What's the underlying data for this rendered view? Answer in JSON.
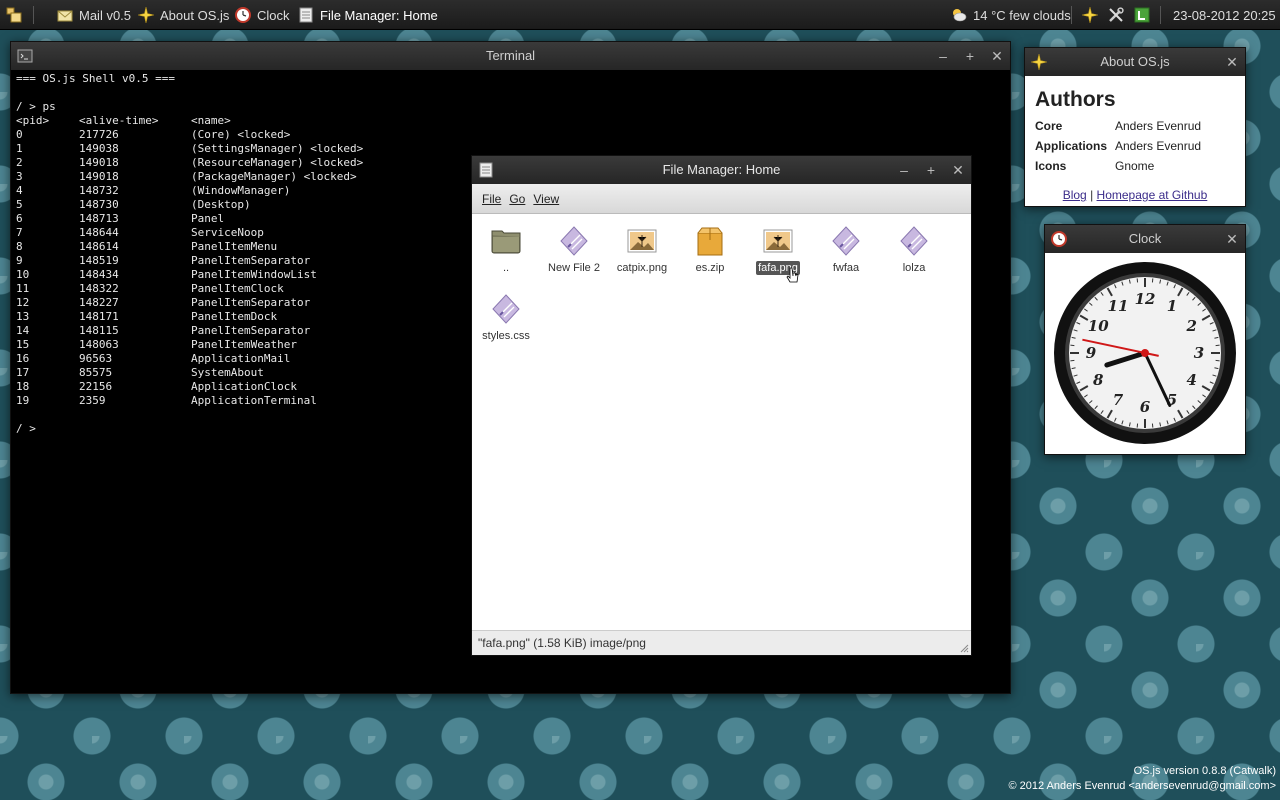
{
  "panel": {
    "items": [
      {
        "label": "Mail v0.5",
        "icon": "mail-icon"
      },
      {
        "label": "About OS.js",
        "icon": "star-icon"
      },
      {
        "label": "Clock",
        "icon": "clock-icon"
      },
      {
        "label": "File Manager: Home",
        "icon": "file-manager-icon"
      }
    ],
    "weather": "14 °C few clouds",
    "datetime": "23-08-2012 20:25"
  },
  "terminal": {
    "title": "Terminal",
    "banner": "=== OS.js Shell v0.5 ===",
    "command": "/ > ps",
    "headers": [
      "<pid>",
      "<alive-time>",
      "<name>"
    ],
    "rows": [
      [
        "0",
        "217726",
        "(Core) <locked>"
      ],
      [
        "1",
        "149038",
        "(SettingsManager) <locked>"
      ],
      [
        "2",
        "149018",
        "(ResourceManager) <locked>"
      ],
      [
        "3",
        "149018",
        "(PackageManager) <locked>"
      ],
      [
        "4",
        "148732",
        "(WindowManager)"
      ],
      [
        "5",
        "148730",
        "(Desktop)"
      ],
      [
        "6",
        "148713",
        "Panel"
      ],
      [
        "7",
        "148644",
        "ServiceNoop"
      ],
      [
        "8",
        "148614",
        "PanelItemMenu"
      ],
      [
        "9",
        "148519",
        "PanelItemSeparator"
      ],
      [
        "10",
        "148434",
        "PanelItemWindowList"
      ],
      [
        "11",
        "148322",
        "PanelItemClock"
      ],
      [
        "12",
        "148227",
        "PanelItemSeparator"
      ],
      [
        "13",
        "148171",
        "PanelItemDock"
      ],
      [
        "14",
        "148115",
        "PanelItemSeparator"
      ],
      [
        "15",
        "148063",
        "PanelItemWeather"
      ],
      [
        "16",
        "96563",
        "ApplicationMail"
      ],
      [
        "17",
        "85575",
        "SystemAbout"
      ],
      [
        "18",
        "22156",
        "ApplicationClock"
      ],
      [
        "19",
        "2359",
        "ApplicationTerminal"
      ]
    ],
    "prompt": "/ >"
  },
  "file_manager": {
    "title": "File Manager: Home",
    "menu": [
      "File",
      "Go",
      "View"
    ],
    "files": [
      {
        "name": "..",
        "icon": "folder-icon"
      },
      {
        "name": "New File 2",
        "icon": "generic-file-icon"
      },
      {
        "name": "catpix.png",
        "icon": "image-file-icon"
      },
      {
        "name": "es.zip",
        "icon": "archive-icon"
      },
      {
        "name": "fafa.png",
        "icon": "image-file-icon",
        "selected": true
      },
      {
        "name": "fwfaa",
        "icon": "generic-file-icon"
      },
      {
        "name": "lolza",
        "icon": "generic-file-icon"
      },
      {
        "name": "styles.css",
        "icon": "generic-file-icon"
      }
    ],
    "status": "\"fafa.png\" (1.58 KiB) image/png"
  },
  "about": {
    "title": "About OS.js",
    "heading": "Authors",
    "rows": [
      {
        "key": "Core",
        "value": "Anders Evenrud"
      },
      {
        "key": "Applications",
        "value": "Anders Evenrud"
      },
      {
        "key": "Icons",
        "value": "Gnome"
      }
    ],
    "link_blog": "Blog",
    "link_sep": "|",
    "link_github": "Homepage at Github"
  },
  "clock": {
    "title": "Clock",
    "time": "20:25:47"
  },
  "footer": {
    "version": "OS.js version 0.8.8 (Catwalk)",
    "copyright": "© 2012 Anders Evenrud <andersevenrud@gmail.com>"
  },
  "colors": {
    "desktop_bg": "#1f4f5a",
    "panel_bg": "#222222",
    "titlebar_bg": "#2f2f2f",
    "selection": "#555555",
    "link": "#3b2c8a"
  }
}
